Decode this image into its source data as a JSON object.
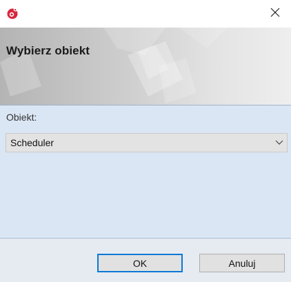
{
  "window": {
    "app_icon": "app-logo-icon",
    "close_icon": "close-icon"
  },
  "header": {
    "title": "Wybierz obiekt"
  },
  "form": {
    "object_label": "Obiekt:",
    "object_value": "Scheduler",
    "dropdown_icon": "chevron-down-icon"
  },
  "buttons": {
    "ok_label": "OK",
    "cancel_label": "Anuluj"
  },
  "colors": {
    "accent": "#0a78d7",
    "brand": "#d7263d",
    "content_bg": "#dbe6f4"
  }
}
